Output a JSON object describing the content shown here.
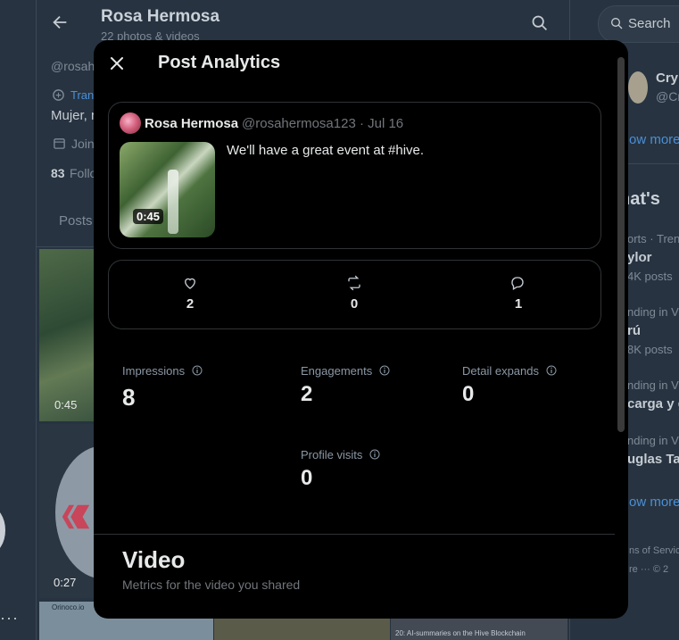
{
  "background": {
    "profile_name": "Rosa Hermosa",
    "profile_sub": "22 photos & videos",
    "handle_partial": "@rosah",
    "translate_partial": "Tran",
    "bio_partial": "Mujer, r",
    "joined_partial": "Join",
    "follows_count": "83",
    "follows_label_partial": "Follo",
    "tab_posts": "Posts",
    "media_durations": [
      "0:45",
      "0:27"
    ],
    "media_3_text": "Orinoco.io",
    "media_5_text": "20: AI-summaries on the Hive Blockchain"
  },
  "right_column": {
    "search_label": "Search",
    "suggest_name_partial": "Cry",
    "suggest_handle_partial": "@Cr",
    "show_more": "ow more",
    "whats_happening_partial": "hat's",
    "trends": [
      {
        "context": "orts · Tren",
        "topic": "ylor",
        "count": "4K posts"
      },
      {
        "context": "nding in V",
        "topic": "rú",
        "count": "8K posts"
      },
      {
        "context": "nding in V",
        "topic": "carga y g",
        "count": ""
      },
      {
        "context": "nding in V",
        "topic": "uglas Ta",
        "count": ""
      }
    ],
    "show_more_2": "ow more",
    "terms_partial": "ns of Servic",
    "more_footer_partial": "re ···  © 2"
  },
  "modal": {
    "title": "Post Analytics",
    "post": {
      "author": "Rosa Hermosa",
      "handle_date": "@rosahermosa123 · Jul 16",
      "text": "We'll have a great event at #hive.",
      "video_duration": "0:45"
    },
    "engagement": {
      "likes": "2",
      "reposts": "0",
      "replies": "1"
    },
    "metrics": [
      {
        "label": "Impressions",
        "value": "8"
      },
      {
        "label": "Engagements",
        "value": "2"
      },
      {
        "label": "Detail expands",
        "value": "0"
      },
      {
        "label": "Profile visits",
        "value": "0"
      }
    ],
    "video_section": {
      "title": "Video",
      "subtitle": "Metrics for the video you shared"
    }
  },
  "colors": {
    "modal_bg": "#000000",
    "dim_bg": "#273340",
    "border": "#2f3336",
    "link": "#1d9bf0",
    "hive_red": "#e31337"
  }
}
